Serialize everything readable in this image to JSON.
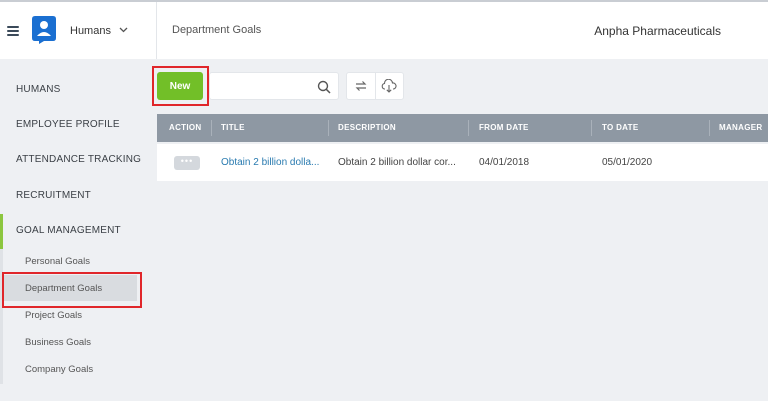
{
  "header": {
    "app_name": "Humans",
    "page_title": "Department Goals",
    "company_name": "Anpha Pharmaceuticals"
  },
  "sidebar": {
    "sections": [
      {
        "label": "HUMANS"
      },
      {
        "label": "EMPLOYEE PROFILE"
      },
      {
        "label": "ATTENDANCE TRACKING"
      },
      {
        "label": "RECRUITMENT"
      },
      {
        "label": "GOAL MANAGEMENT"
      }
    ],
    "goal_items": [
      {
        "label": "Personal Goals"
      },
      {
        "label": "Department Goals"
      },
      {
        "label": "Project Goals"
      },
      {
        "label": "Business Goals"
      },
      {
        "label": "Company Goals"
      }
    ],
    "active_item": "Department Goals"
  },
  "toolbar": {
    "new_label": "New",
    "search_value": "",
    "search_placeholder": ""
  },
  "table": {
    "columns": [
      "ACTION",
      "TITLE",
      "DESCRIPTION",
      "FROM DATE",
      "TO DATE",
      "MANAGER"
    ],
    "rows": [
      {
        "action": "•••",
        "title": "Obtain 2 billion dolla...",
        "description": "Obtain 2 billion dollar cor...",
        "from_date": "04/01/2018",
        "to_date": "05/01/2020",
        "manager": ""
      }
    ]
  },
  "colors": {
    "accent_green": "#72bf28",
    "highlight_red": "#e0262a",
    "table_header": "#8e98a3",
    "link_blue": "#2a7bb0"
  }
}
